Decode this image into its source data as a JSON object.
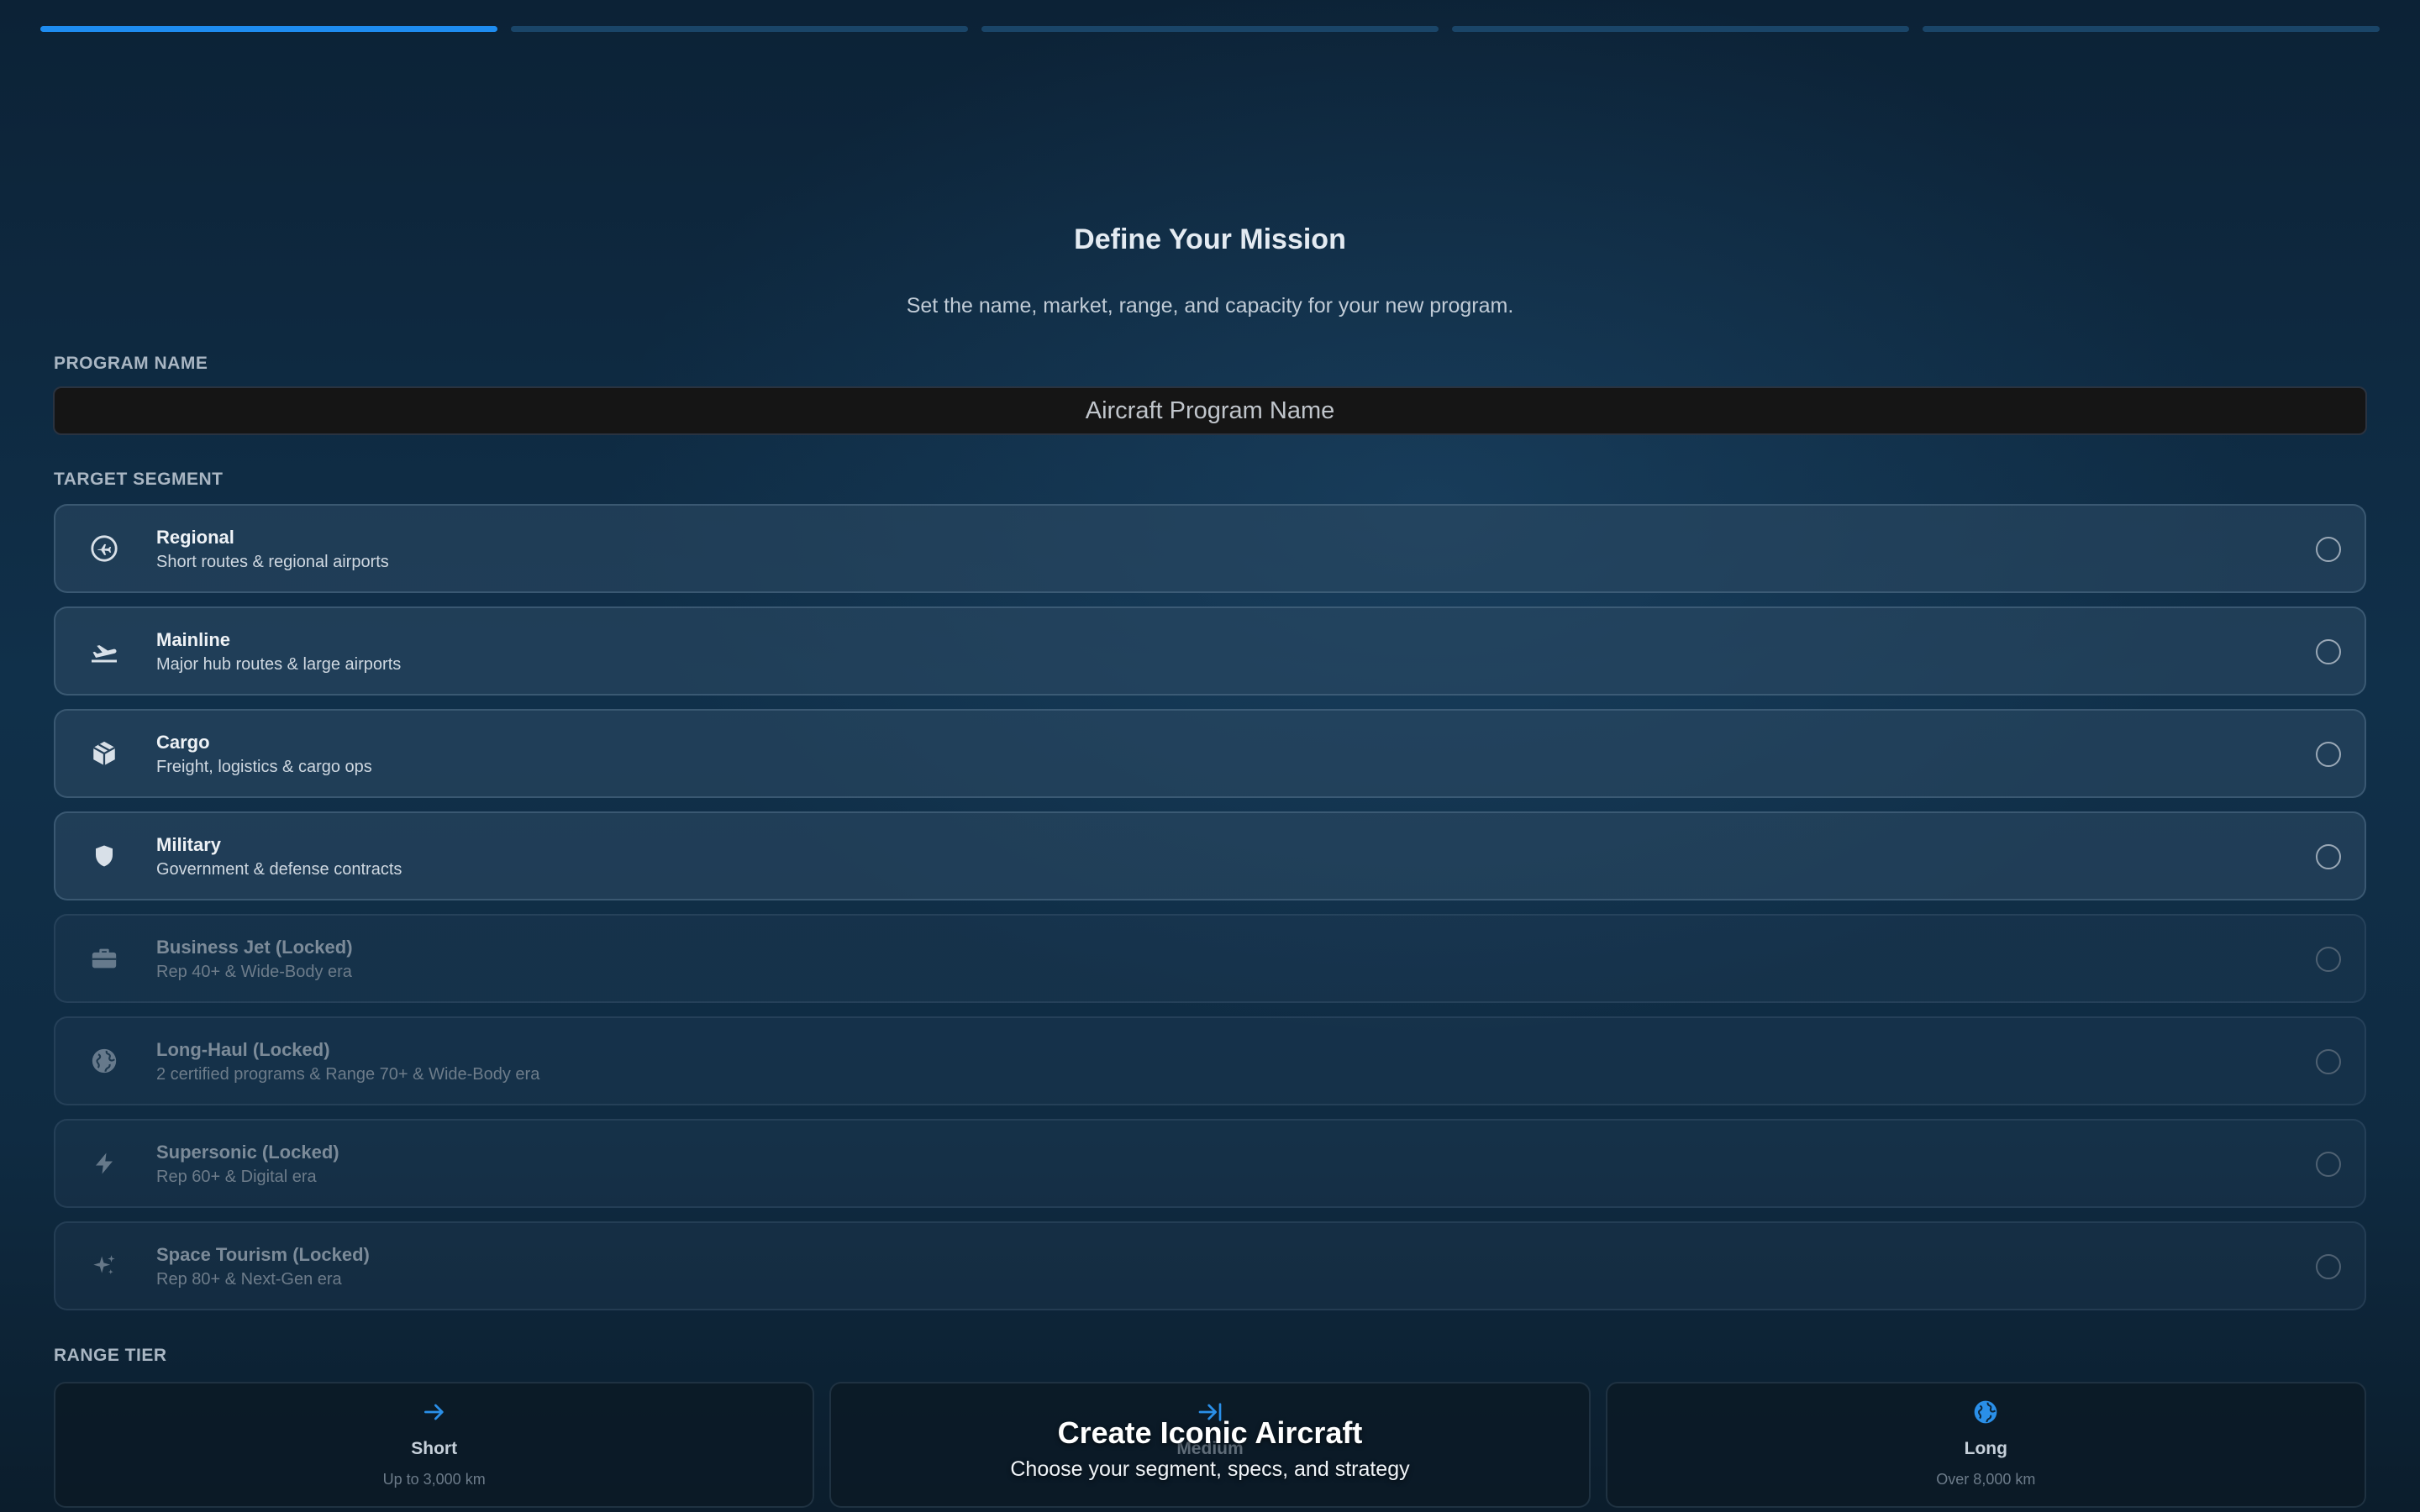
{
  "progress": {
    "total_steps": 5,
    "current_step": 1
  },
  "header": {
    "title": "Define Your Mission",
    "subtitle": "Set the name, market, range, and capacity for your new program."
  },
  "program_name": {
    "label": "PROGRAM NAME",
    "value": "",
    "placeholder": "Aircraft Program Name"
  },
  "segments": {
    "label": "TARGET SEGMENT",
    "items": [
      {
        "name": "Regional",
        "desc": "Short routes & regional airports",
        "icon": "plane-circle-icon",
        "locked": false
      },
      {
        "name": "Mainline",
        "desc": "Major hub routes & large airports",
        "icon": "plane-takeoff-icon",
        "locked": false
      },
      {
        "name": "Cargo",
        "desc": "Freight, logistics & cargo ops",
        "icon": "package-icon",
        "locked": false
      },
      {
        "name": "Military",
        "desc": "Government & defense contracts",
        "icon": "shield-icon",
        "locked": false
      },
      {
        "name": "Business Jet (Locked)",
        "desc": "Rep 40+ & Wide-Body era",
        "icon": "briefcase-icon",
        "locked": true
      },
      {
        "name": "Long-Haul (Locked)",
        "desc": "2 certified programs & Range 70+ & Wide-Body era",
        "icon": "globe-icon",
        "locked": true
      },
      {
        "name": "Supersonic (Locked)",
        "desc": "Rep 60+ & Digital era",
        "icon": "lightning-icon",
        "locked": true
      },
      {
        "name": "Space Tourism (Locked)",
        "desc": "Rep 80+ & Next-Gen era",
        "icon": "sparkle-icon",
        "locked": true
      }
    ]
  },
  "range": {
    "label": "RANGE TIER",
    "tiers": [
      {
        "name": "Short",
        "desc": "Up to 3,000 km",
        "icon": "arrow-right-icon"
      },
      {
        "name": "Medium",
        "desc": "",
        "icon": "arrow-right-to-line-icon"
      },
      {
        "name": "Long",
        "desc": "Over 8,000 km",
        "icon": "globe-icon"
      }
    ]
  },
  "overlay": {
    "title": "Create Iconic Aircraft",
    "subtitle": "Choose your segment, specs, and strategy"
  },
  "colors": {
    "accent": "#1e8cf0",
    "track": "#1a4568",
    "input_bg": "#151515"
  }
}
